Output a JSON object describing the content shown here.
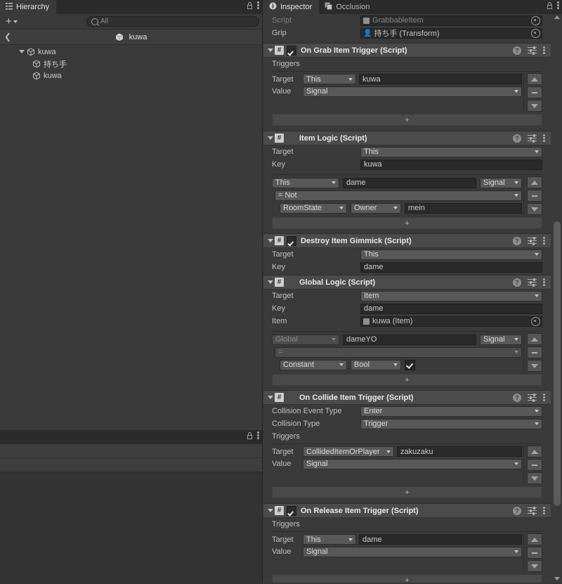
{
  "hierarchy": {
    "tab_label": "Hierarchy",
    "tab_icon": "hierarchy-icon",
    "toolbar": {
      "add_label": "+",
      "search_placeholder": "All",
      "search_value": ""
    },
    "breadcrumb": {
      "back_icon": "chevron-left-icon",
      "prefab_name": "kuwa"
    },
    "items": [
      {
        "label": "kuwa",
        "depth": 0,
        "expanded": true
      },
      {
        "label": "持ち手",
        "depth": 1,
        "expanded": false
      },
      {
        "label": "kuwa",
        "depth": 1,
        "expanded": false
      }
    ]
  },
  "bottom_panel": {
    "lock_icon": "lock-icon",
    "menu_icon": "kebab-menu-icon"
  },
  "inspector": {
    "tabs": [
      {
        "label": "Inspector",
        "icon": "info-icon",
        "active": true
      },
      {
        "label": "Occlusion",
        "icon": "occlusion-icon",
        "active": false
      }
    ],
    "lock_icon": "lock-icon",
    "menu_icon": "kebab-menu-icon",
    "top_fields": [
      {
        "label": "Script",
        "value": "GrabbableItem",
        "kind": "object",
        "disabled": true,
        "icon": "script-asset-icon"
      },
      {
        "label": "Grip",
        "value": "持ち手 (Transform)",
        "kind": "object",
        "disabled": false,
        "icon": "transform-icon"
      }
    ],
    "components": [
      {
        "title": "On Grab Item Trigger (Script)",
        "has_checkbox": true,
        "checked": true,
        "section_label": "Triggers",
        "rows": [
          {
            "label": "Target",
            "popup": "This",
            "text": "kuwa"
          },
          {
            "label": "Value",
            "popup": "Signal",
            "text": null
          }
        ],
        "add_label": "+"
      },
      {
        "title": "Item Logic (Script)",
        "has_checkbox": false,
        "checked": false,
        "fields": [
          {
            "label": "Target",
            "kind": "popup",
            "value": "This"
          },
          {
            "label": "Key",
            "kind": "text",
            "value": "kuwa"
          }
        ],
        "logic": {
          "source_popup": "This",
          "key_text": "dame",
          "type_popup": "Signal",
          "op_popup": "= Not",
          "cmp_popup": "RoomState",
          "cmp_popup2": "Owner",
          "cmp_text": "mein"
        },
        "add_label": "+"
      },
      {
        "title": "Destroy Item Gimmick (Script)",
        "has_checkbox": true,
        "checked": true,
        "fields": [
          {
            "label": "Target",
            "kind": "popup",
            "value": "This"
          },
          {
            "label": "Key",
            "kind": "text",
            "value": "dame"
          }
        ]
      },
      {
        "title": "Global Logic (Script)",
        "has_checkbox": false,
        "checked": false,
        "fields": [
          {
            "label": "Target",
            "kind": "popup",
            "value": "Item"
          },
          {
            "label": "Key",
            "kind": "text",
            "value": "dame"
          },
          {
            "label": "Item",
            "kind": "object",
            "value": "kuwa (Item)"
          }
        ],
        "logic": {
          "source_popup": "Global",
          "source_disabled": true,
          "key_text": "dameYO",
          "type_popup": "Signal",
          "op_popup": "=",
          "cmp_popup": "Constant",
          "cmp_popup2": "Bool",
          "bool_checked": true
        },
        "add_label": "+"
      },
      {
        "title": "On Collide Item Trigger (Script)",
        "has_checkbox": false,
        "checked": false,
        "fields": [
          {
            "label": "Collision Event Type",
            "kind": "popup",
            "value": "Enter"
          },
          {
            "label": "Collision Type",
            "kind": "popup",
            "value": "Trigger"
          }
        ],
        "section_label": "Triggers",
        "rows": [
          {
            "label": "Target",
            "popup": "CollidedItemOrPlayer",
            "text": "zakuzaku"
          },
          {
            "label": "Value",
            "popup": "Signal",
            "text": null
          }
        ],
        "add_label": "+"
      },
      {
        "title": "On Release Item Trigger (Script)",
        "has_checkbox": true,
        "checked": true,
        "section_label": "Triggers",
        "rows": [
          {
            "label": "Target",
            "popup": "This",
            "text": "dame"
          },
          {
            "label": "Value",
            "popup": "Signal",
            "text": null
          }
        ],
        "add_label": "+"
      }
    ],
    "list_buttons": {
      "up": "move-up",
      "remove": "-",
      "down": "move-down"
    }
  },
  "colors": {
    "window_bg": "#3a3a3a",
    "tabbar_bg": "#2b2b2b",
    "component_header_bg": "#4b4b4b",
    "field_bg": "#2a2a2a",
    "popup_bg": "#585858",
    "scrollbar_thumb": "#5c5c5c"
  }
}
